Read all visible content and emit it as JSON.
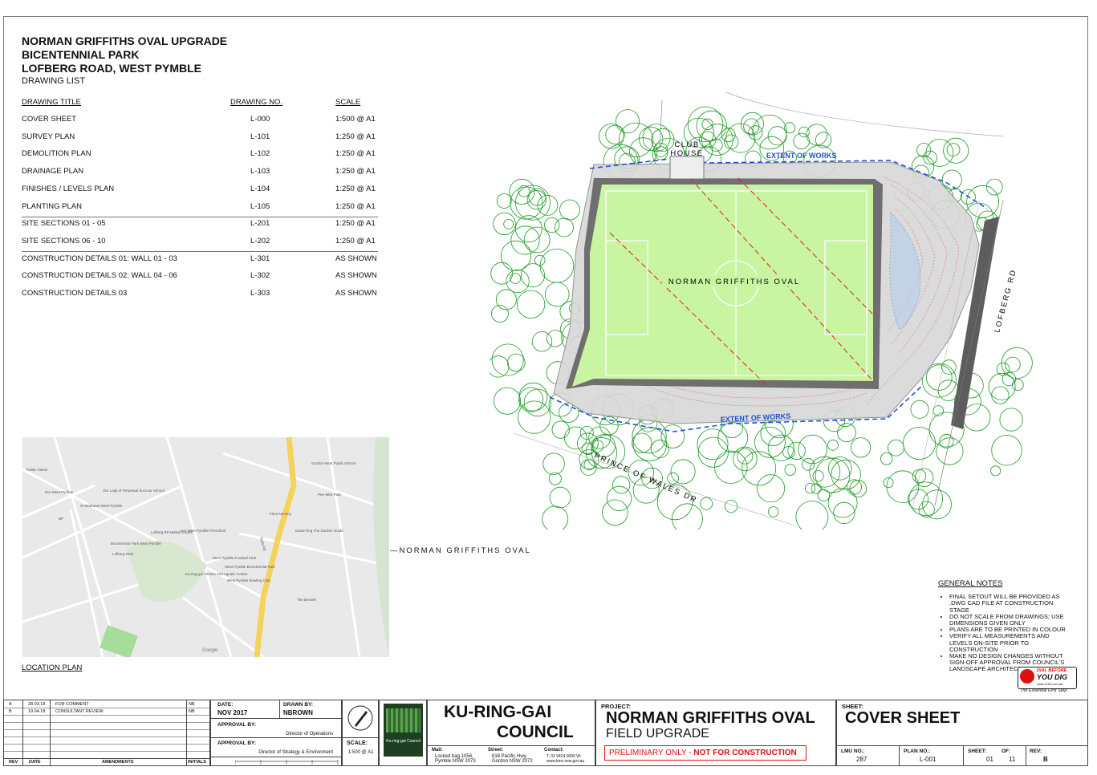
{
  "header": {
    "line1": "NORMAN GRIFFITHS OVAL UPGRADE",
    "line2": "BICENTENNIAL PARK",
    "line3": "LOFBERG ROAD, WEST PYMBLE",
    "line4": "DRAWING LIST"
  },
  "drawing_list": {
    "col_title": "DRAWING TITLE",
    "col_no": "DRAWING NO.",
    "col_scale": "SCALE",
    "rows": [
      {
        "title": "COVER SHEET",
        "no": "L-000",
        "scale": "1:500 @ A1"
      },
      {
        "title": "SURVEY PLAN",
        "no": "L-101",
        "scale": "1:250 @ A1"
      },
      {
        "title": "DEMOLITION PLAN",
        "no": "L-102",
        "scale": "1:250 @ A1"
      },
      {
        "title": "DRAINAGE PLAN",
        "no": "L-103",
        "scale": "1:250 @ A1"
      },
      {
        "title": "FINISHES / LEVELS PLAN",
        "no": "L-104",
        "scale": "1:250 @ A1"
      },
      {
        "title": "PLANTING PLAN",
        "no": "L-105",
        "scale": "1:250 @ A1"
      },
      {
        "title": "SITE SECTIONS 01 - 05",
        "no": "L-201",
        "scale": "1:250 @ A1"
      },
      {
        "title": "SITE SECTIONS 06 - 10",
        "no": "L-202",
        "scale": "1:250 @ A1"
      },
      {
        "title": "CONSTRUCTION DETAILS 01: WALL 01 - 03",
        "no": "L-301",
        "scale": "AS SHOWN"
      },
      {
        "title": "CONSTRUCTION DETAILS 02: WALL 04 - 06",
        "no": "L-302",
        "scale": "AS SHOWN"
      },
      {
        "title": "CONSTRUCTION DETAILS 03",
        "no": "L-303",
        "scale": "AS SHOWN"
      }
    ]
  },
  "plan": {
    "club_house_1": "CLUB",
    "club_house_2": "HOUSE",
    "extent_top": "EXTENT OF WORKS",
    "extent_bottom": "EXTENT OF WORKS",
    "oval_label": "NORMAN GRIFFITHS OVAL",
    "road_right": "LOFBERG RD",
    "road_bottom": "PRINCE OF WALES DR"
  },
  "location": {
    "pointer_label": "NORMAN GRIFFITHS OVAL",
    "caption": "LOCATION PLAN",
    "map_labels": [
      "Public Toilets",
      "IGA West Pymble",
      "Our Lady of Perpetual Succour School",
      "St Matthews West Pymble",
      "BP",
      "Lofberg Rd Netball Courts",
      "KU West Pymble Preschool",
      "Bicentennial Park West Pymble",
      "Lofberg Oval",
      "West Pymble Football Club",
      "West Pymble Bicentennial Park",
      "Ku-ring-gai Fitness And Aquatic Centre",
      "West Pymble Bowling Club",
      "Gordon West Public School",
      "Pee Wee Park",
      "Flora Nursery",
      "David Ting The Garden Guide",
      "The Bessell",
      "Ryde Rd",
      "Google"
    ]
  },
  "notes": {
    "title": "GENERAL NOTES",
    "items": [
      "FINAL SETOUT WILL BE PROVIDED AS .DWG CAD FILE AT CONSTRUCTION STAGE",
      "DO NOT SCALE FROM DRAWINGS; USE DIMENSIONS GIVEN ONLY",
      "PLANS ARE TO BE PRINTED IN COLOUR",
      "VERIFY ALL MEASUREMENTS AND LEVELS ON-SITE PRIOR TO CONSTRUCTION",
      "MAKE NO DESIGN CHANGES WITHOUT SIGN-OFF APPROVAL FROM COUNCIL'S LANDSCAPE ARCHITECT"
    ]
  },
  "dial": {
    "line1": "DIAL BEFORE",
    "line2": "YOU DIG",
    "url": "www.1100.com.au",
    "tagline": "The Essential First Step"
  },
  "revisions": {
    "rows": [
      {
        "rev": "A",
        "date": "28.03.18",
        "amend": "FOR COMMENT",
        "init": "NB"
      },
      {
        "rev": "B",
        "date": "10.04.18",
        "amend": "CONSULTANT REVIEW",
        "init": "NB"
      }
    ],
    "h_rev": "REV",
    "h_date": "DATE",
    "h_amend": "AMENDMENTS",
    "h_init": "INITIALS"
  },
  "titleblock": {
    "date_lbl": "DATE:",
    "date_val": "NOV 2017",
    "drawn_lbl": "DRAWN BY:",
    "drawn_val": "NBROWN",
    "approval1_lbl": "APPROVAL BY:",
    "approval1_role": "Director of Operations",
    "approval2_lbl": "APPROVAL BY:",
    "approval2_role": "Director of Strategy & Environment",
    "scale_lbl": "SCALE:",
    "scale_val": "1:500 @ A1",
    "council_logo": "Ku-ring-gai Council",
    "council_1": "KU-RING-GAI",
    "council_2": "COUNCIL",
    "mail_lbl": "Mail:",
    "mail_val": "Locked bag 1056, Pymble NSW 2073",
    "street_lbl": "Street:",
    "street_val": "818 Pacific Hwy, Gordon NSW 2072",
    "contact_lbl": "Contact:",
    "contact_val": "T: 02 9424 0000 W: www.kmc.nsw.gov.au",
    "project_lbl": "PROJECT:",
    "project_1": "NORMAN GRIFFITHS OVAL",
    "project_2": "FIELD UPGRADE",
    "prelim_a": "PRELIMINARY ONLY -",
    "prelim_b": "NOT FOR CONSTRUCTION",
    "sheet_lbl": "SHEET:",
    "sheet_val": "COVER SHEET",
    "lmu_lbl": "LMU NO.:",
    "lmu_val": "287",
    "planno_lbl": "PLAN NO.:",
    "planno_val": "L-001",
    "sheetno_lbl": "SHEET:",
    "sheetno_val": "01",
    "of_lbl": "OF:",
    "of_val": "11",
    "rev_lbl": "REV:",
    "rev_val": "B"
  }
}
